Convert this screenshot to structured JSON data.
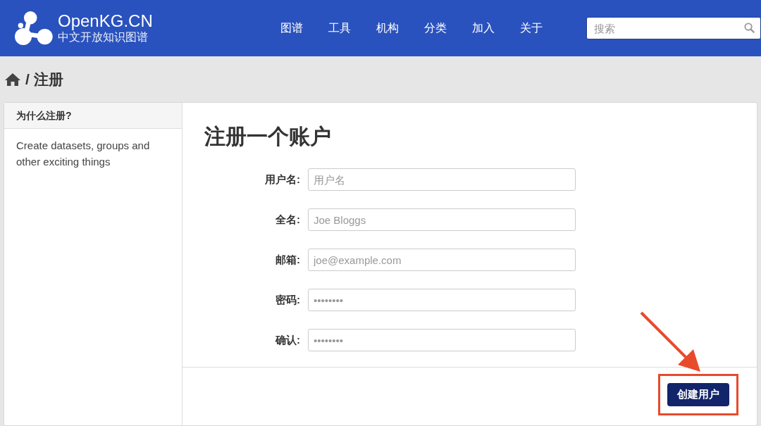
{
  "brand": {
    "name": "OpenKG.CN",
    "subtitle": "中文开放知识图谱"
  },
  "nav": [
    "图谱",
    "工具",
    "机构",
    "分类",
    "加入",
    "关于"
  ],
  "search": {
    "placeholder": "搜索"
  },
  "breadcrumb": {
    "separator": "/",
    "current": "注册"
  },
  "sidebar": {
    "heading": "为什么注册?",
    "text": "Create datasets, groups and other exciting things"
  },
  "form": {
    "title": "注册一个账户",
    "fields": [
      {
        "label": "用户名:",
        "placeholder": "用户名"
      },
      {
        "label": "全名:",
        "placeholder": "Joe Bloggs"
      },
      {
        "label": "邮箱:",
        "placeholder": "joe@example.com"
      },
      {
        "label": "密码:",
        "placeholder": "••••••••"
      },
      {
        "label": "确认:",
        "placeholder": "••••••••"
      }
    ],
    "submit": "创建用户"
  },
  "annotation": {
    "highlight_submit": true
  }
}
